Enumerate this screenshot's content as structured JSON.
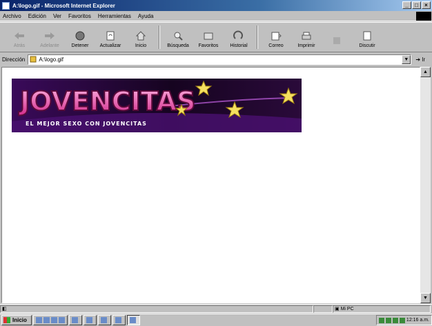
{
  "window": {
    "title": "A:\\logo.gif - Microsoft Internet Explorer"
  },
  "menu": [
    "Archivo",
    "Edición",
    "Ver",
    "Favoritos",
    "Herramientas",
    "Ayuda"
  ],
  "toolbar": [
    {
      "label": "Atrás",
      "icon": "back-arrow-icon",
      "enabled": false
    },
    {
      "label": "Adelante",
      "icon": "forward-arrow-icon",
      "enabled": false
    },
    {
      "label": "Detener",
      "icon": "stop-icon",
      "enabled": true
    },
    {
      "label": "Actualizar",
      "icon": "refresh-icon",
      "enabled": true
    },
    {
      "label": "Inicio",
      "icon": "home-icon",
      "enabled": true
    },
    {
      "label": "Búsqueda",
      "icon": "search-icon",
      "enabled": true
    },
    {
      "label": "Favoritos",
      "icon": "favorites-icon",
      "enabled": true
    },
    {
      "label": "Historial",
      "icon": "history-icon",
      "enabled": true
    },
    {
      "label": "Correo",
      "icon": "mail-icon",
      "enabled": true
    },
    {
      "label": "Imprimir",
      "icon": "print-icon",
      "enabled": true
    },
    {
      "label": "",
      "icon": "edit-icon",
      "enabled": false
    },
    {
      "label": "Discutir",
      "icon": "discuss-icon",
      "enabled": true
    }
  ],
  "address": {
    "label": "Dirección",
    "value": "A:\\logo.gif",
    "go": "Ir"
  },
  "banner": {
    "title": "JOVENCITAS",
    "tagline": "EL MEJOR SEXO CON JOVENCITAS"
  },
  "status": {
    "left": "",
    "zone": "Mi PC"
  },
  "taskbar": {
    "start": "Inicio",
    "buttons": [
      "",
      "",
      "",
      "",
      ""
    ],
    "clock": "12:16 a.m."
  },
  "colors": {
    "titlebar": "#0a246a",
    "chrome": "#c0c0c0",
    "banner_bg": "#2a0a3a",
    "title_pink": "#f07ac0",
    "star": "#f5e060"
  }
}
